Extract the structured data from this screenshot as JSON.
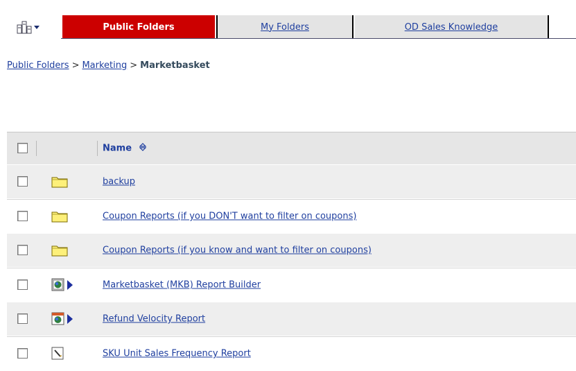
{
  "tabs": {
    "views_icon": "views-menu-icon",
    "active": "Public Folders",
    "my_folders": "My Folders",
    "od_sales": "OD Sales Knowledge"
  },
  "breadcrumb": {
    "items": [
      "Public Folders",
      "Marketing"
    ],
    "separator": ">",
    "current": "Marketbasket"
  },
  "table": {
    "header": {
      "name": "Name"
    },
    "rows": [
      {
        "name": "backup",
        "type": "folder"
      },
      {
        "name": "Coupon Reports (if you DON'T want to filter on coupons)",
        "type": "folder"
      },
      {
        "name": "Coupon Reports (if you know and want to filter on coupons)",
        "type": "folder"
      },
      {
        "name": "Marketbasket (MKB) Report Builder",
        "type": "report-view"
      },
      {
        "name": "Refund Velocity Report",
        "type": "report-run"
      },
      {
        "name": "SKU Unit Sales Frequency Report",
        "type": "report-edit"
      }
    ]
  },
  "colors": {
    "active_tab": "#cc0000",
    "link": "#1f3f9f",
    "row_alt": "#eeeeee"
  }
}
